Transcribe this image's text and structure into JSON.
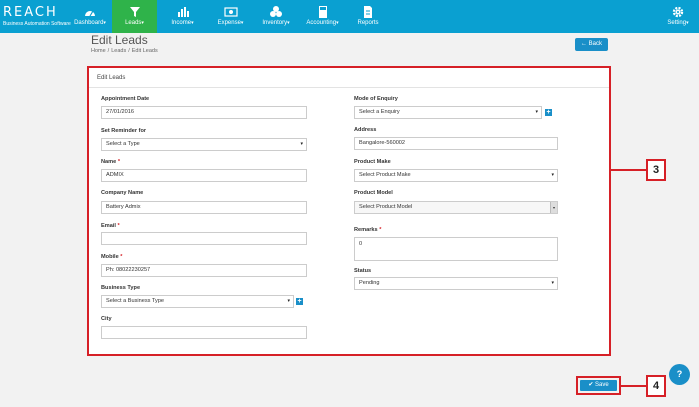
{
  "logo": {
    "brand": "REACH",
    "tagline": "Business Automation Software"
  },
  "nav": [
    {
      "label": "Dashboard",
      "icon": "dashboard-icon"
    },
    {
      "label": "Leads",
      "icon": "leads-icon",
      "active": true
    },
    {
      "label": "Income",
      "icon": "income-icon"
    },
    {
      "label": "Expense",
      "icon": "expense-icon"
    },
    {
      "label": "Inventory",
      "icon": "inventory-icon"
    },
    {
      "label": "Accounting",
      "icon": "accounting-icon"
    },
    {
      "label": "Reports",
      "icon": "reports-icon"
    },
    {
      "label": "Setting",
      "icon": "gear-icon"
    }
  ],
  "page": {
    "title": "Edit Leads",
    "breadcrumb": [
      "Home",
      "/",
      "Leads",
      "/",
      "Edit Leads"
    ],
    "back_label": "← Back"
  },
  "form": {
    "panel_title": "Edit Leads",
    "left": {
      "appointment_date": {
        "label": "Appointment Date",
        "value": "27/01/2016"
      },
      "reminder": {
        "label": "Set Reminder for",
        "value": "Select a Type"
      },
      "name": {
        "label": "Name",
        "value": "ADMIX"
      },
      "company": {
        "label": "Company Name",
        "value": "Battery Admix"
      },
      "email": {
        "label": "Email",
        "value": ""
      },
      "mobile": {
        "label": "Mobile",
        "value": "Ph: 08022230257"
      },
      "business_type": {
        "label": "Business Type",
        "value": "Select a Business Type"
      },
      "city": {
        "label": "City",
        "value": ""
      }
    },
    "right": {
      "enquiry": {
        "label": "Mode of Enquiry",
        "value": "Select a Enquiry"
      },
      "address": {
        "label": "Address",
        "value": "Bangalore-560002"
      },
      "product_make": {
        "label": "Product Make",
        "value": "Select Product Make"
      },
      "product_model": {
        "label": "Product Model",
        "value": "Select Product Model"
      },
      "remarks": {
        "label": "Remarks",
        "value": "0"
      },
      "status": {
        "label": "Status",
        "value": "Pending"
      }
    },
    "required_mark": "*",
    "plus_glyph": "+",
    "caret_glyph": "▾"
  },
  "save_label": "✔ Save",
  "callouts": {
    "form": "3",
    "save": "4"
  },
  "help_glyph": "?",
  "colors": {
    "nav_bg": "#0aa0d1",
    "nav_active": "#2fb34a",
    "button": "#1a8fc8",
    "callout": "#d62027"
  }
}
